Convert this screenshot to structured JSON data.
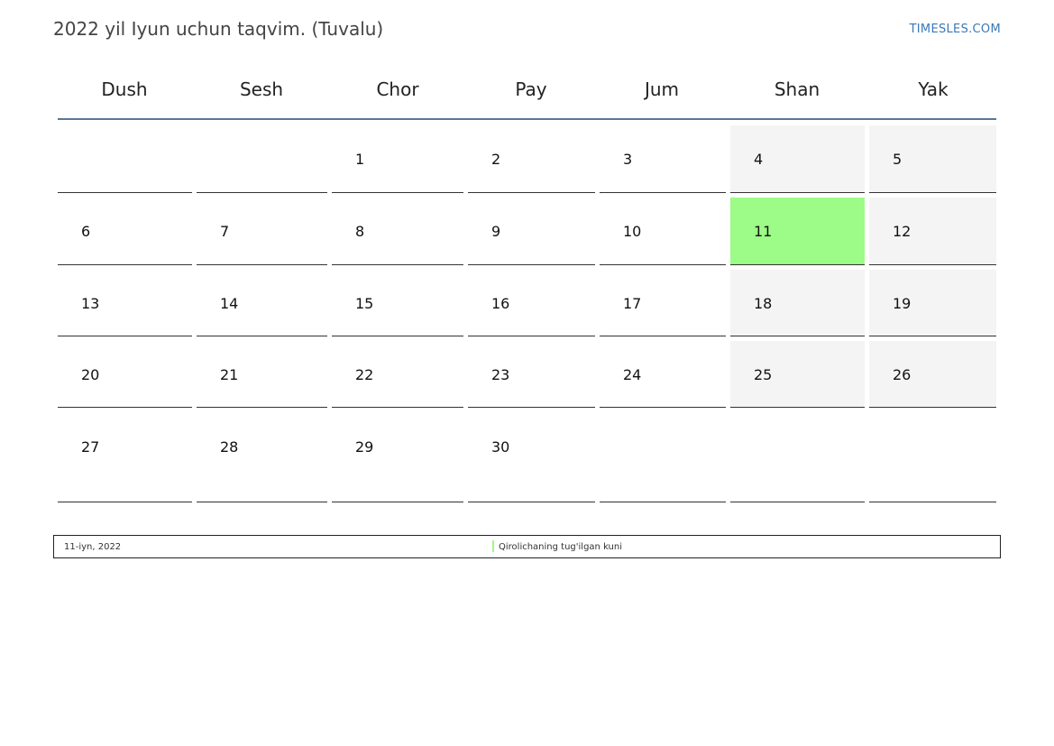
{
  "header": {
    "title": "2022 yil Iyun uchun taqvim. (Tuvalu)",
    "brand": "TIMESLES.COM"
  },
  "weekdays": [
    "Dush",
    "Sesh",
    "Chor",
    "Pay",
    "Jum",
    "Shan",
    "Yak"
  ],
  "weeks": [
    [
      "",
      "",
      "1",
      "2",
      "3",
      "4",
      "5"
    ],
    [
      "6",
      "7",
      "8",
      "9",
      "10",
      "11",
      "12"
    ],
    [
      "13",
      "14",
      "15",
      "16",
      "17",
      "18",
      "19"
    ],
    [
      "20",
      "21",
      "22",
      "23",
      "24",
      "25",
      "26"
    ],
    [
      "27",
      "28",
      "29",
      "30",
      "",
      "",
      ""
    ]
  ],
  "weekend_columns": [
    5,
    6
  ],
  "holidays": [
    "11"
  ],
  "legend": {
    "date": "11-iyn, 2022",
    "name": "Qirolichaning tug'ilgan kuni",
    "color": "#9dfb88"
  },
  "colors": {
    "weekend": "#f4f4f4",
    "holiday": "#9dfb88",
    "header_line": "#5b7594",
    "brand": "#3a78b8"
  }
}
